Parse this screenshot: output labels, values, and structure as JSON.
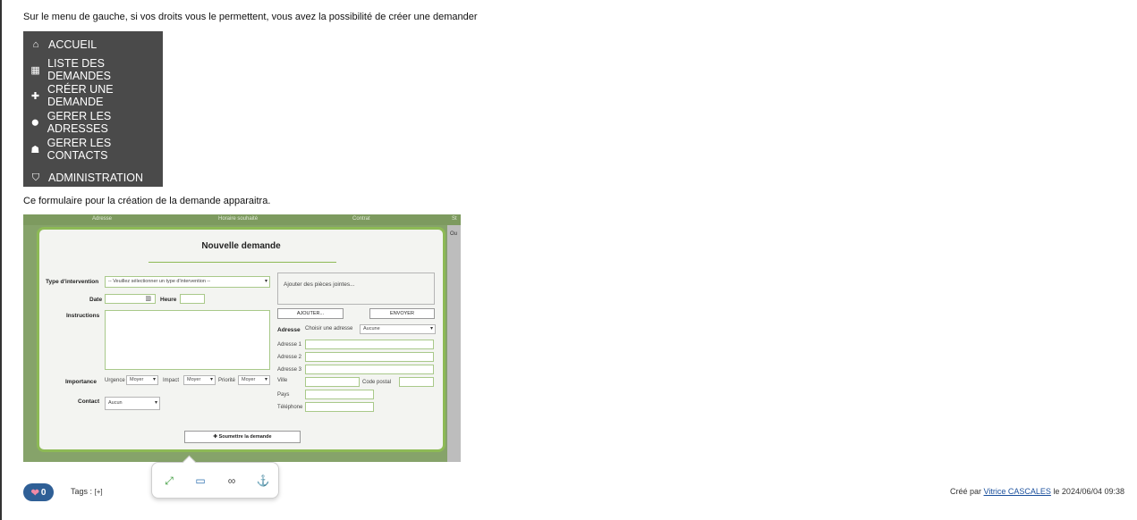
{
  "intro_text": "Sur le menu de gauche, si vos droits vous le permettent, vous avez la possibilité de créer une demander",
  "menu": {
    "items": [
      {
        "icon": "home-icon",
        "glyph": "⌂",
        "label": "ACCUEIL"
      },
      {
        "icon": "table-icon",
        "glyph": "▦",
        "label": "LISTE DES DEMANDES"
      },
      {
        "icon": "plus-icon",
        "glyph": "✚",
        "label": "CRÉER UNE DEMANDE"
      },
      {
        "icon": "map-marker-icon",
        "glyph": "⬤",
        "label": "GERER LES ADRESSES"
      },
      {
        "icon": "users-icon",
        "glyph": "☗",
        "label": "GERER LES CONTACTS"
      },
      {
        "icon": "shield-icon",
        "glyph": "⛉",
        "label": "ADMINISTRATION"
      }
    ]
  },
  "intro2_text": "Ce formulaire pour la création de la demande apparaitra.",
  "form_shot": {
    "header_cols": [
      "Adresse",
      "Horaire souhaité",
      "Contrat",
      "St"
    ],
    "side_label": "Ou",
    "title": "Nouvelle demande",
    "type_label": "Type d'intervention",
    "type_value": "-- Veuillez sélectionner un type d'intervention --",
    "date_label": "Date",
    "heure_label": "Heure",
    "instructions_label": "Instructions",
    "importance_label": "Importance",
    "urgence_label": "Urgence",
    "urgence_value": "Moyer",
    "impact_label": "Impact",
    "impact_value": "Moyer",
    "priorite_label": "Priorité",
    "priorite_value": "Moyer",
    "contact_label": "Contact",
    "contact_value": "Aucun",
    "attach_text": "Ajouter des pièces jointes...",
    "ajouter_button": "AJOUTER...",
    "envoyer_button": "ENVOYER",
    "adresse_label": "Adresse",
    "choisir_label": "Choisir une adresse",
    "choisir_value": "Aucune",
    "adresse1_label": "Adresse 1",
    "adresse2_label": "Adresse 2",
    "adresse3_label": "Adresse 3",
    "ville_label": "Ville",
    "code_postal_label": "Code postal",
    "pays_label": "Pays",
    "telephone_label": "Téléphone",
    "submit_button": "Soumettre la demande"
  },
  "toolbar": {
    "expand_icon": "expand-icon",
    "image_icon": "image-icon",
    "link_icon": "link-icon",
    "anchor_icon": "anchor-icon"
  },
  "footer": {
    "like_count": "0",
    "tags_label": "Tags :",
    "tags_add": "[+]",
    "created_prefix": "Créé par",
    "author": "Vitrice CASCALES",
    "created_suffix": "le 2024/06/04 09:38"
  }
}
